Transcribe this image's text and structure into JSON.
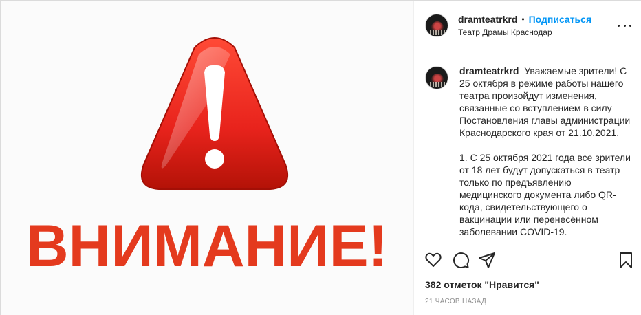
{
  "media": {
    "alt_text": "ВНИМАНИЕ!",
    "colors": {
      "triangle": "#e8231c",
      "triangle_dark": "#b31207",
      "text": "#e43a1e",
      "background": "#fbfbfb"
    }
  },
  "header": {
    "username": "dramteatrkrd",
    "separator": "•",
    "follow_label": "Подписаться",
    "location": "Театр Драмы Краснодар"
  },
  "caption": {
    "username": "dramteatrkrd",
    "paragraph1": "Уважаемые зрители! С 25 октября в режиме работы нашего театра произойдут изменения, связанные со вступлением в силу Постановления главы администрации Краснодарского края от 21.10.2021.",
    "paragraph2": "1. С 25 октября 2021 года все зрители от 18 лет будут допускаться в театр только по предъявлению медицинского документа либо QR-кода, свидетельствующего о вакцинации или перенесённом заболевании COVID-19."
  },
  "actions": {
    "icons": [
      "heart-icon",
      "comment-icon",
      "share-icon",
      "bookmark-icon"
    ]
  },
  "likes_text": "382 отметок \"Нравится\"",
  "time_text": "21 ЧАСОВ НАЗАД",
  "colors": {
    "accent": "#0095f6",
    "text": "#262626",
    "muted": "#8e8e8e",
    "border": "#efefef"
  }
}
